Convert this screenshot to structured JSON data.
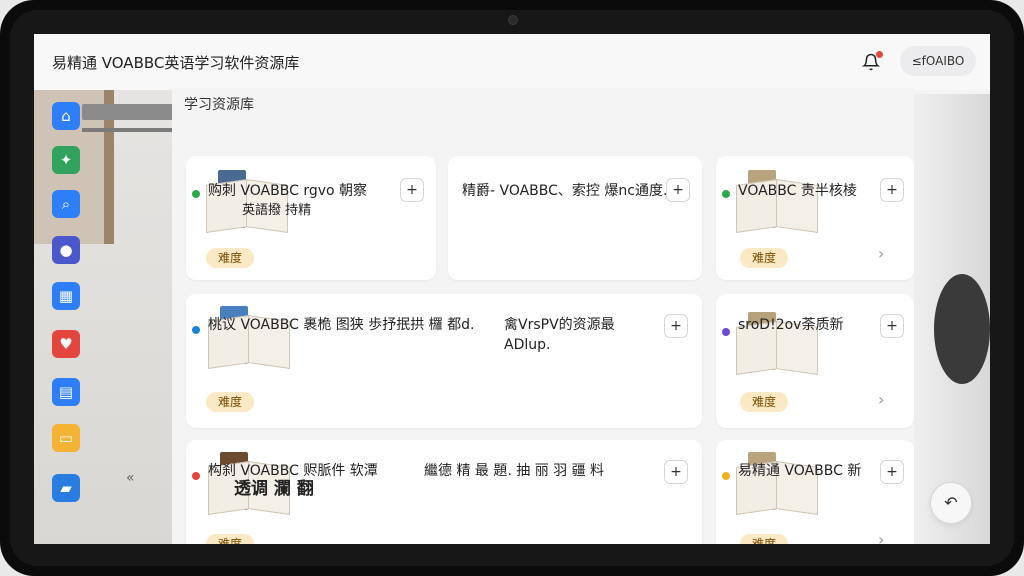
{
  "app": {
    "title": "易精通 VOABBC英语学习软件资源库",
    "user_label": "≤fOAIBO"
  },
  "section": {
    "title": "学习资源库"
  },
  "badge_label": "难度",
  "cards": [
    {
      "title": "购刺 VOABBC rgvo 朝察",
      "subtitle": "英語撥 持精",
      "has_book": true,
      "spine": "#4a6a91",
      "gem": "#2aa84a"
    },
    {
      "title": "精爵- VOABBC、索控 爆nc通度.",
      "subtitle": "",
      "has_book": false,
      "spine": "",
      "gem": ""
    },
    {
      "title": "VOABBC 责半核棱",
      "subtitle": "",
      "has_book": true,
      "spine": "#b7a47d",
      "gem": "#2aa84a"
    },
    {
      "title": "桃议 VOABBC 裹桅 图狭 歩抒抿拱 欏 都d.",
      "subtitle": "",
      "has_book": true,
      "spine": "#4a7fbd",
      "gem": "#1a83d8"
    },
    {
      "title": "禽VrsPV的资源最",
      "subtitle": "ADlup.",
      "has_book": false,
      "spine": "",
      "gem": ""
    },
    {
      "title": "sroD!2ov荼质新",
      "subtitle": "",
      "has_book": true,
      "spine": "#b6a27b",
      "gem": "#6c4bd1"
    },
    {
      "title": "构刹 VOABBC 赆脈件 软潭",
      "subtitle": "透调 瀾 翻",
      "has_book": true,
      "spine": "#6d4b2e",
      "gem": "#e2453a"
    },
    {
      "title": "繼德 精 最 題. 抽 丽 羽 疆 料",
      "subtitle": "",
      "has_book": false,
      "spine": "",
      "gem": ""
    },
    {
      "title": "易精通 VOABBC 新",
      "subtitle": "",
      "has_book": true,
      "spine": "#b9a47e",
      "gem": "#f2b21f"
    }
  ],
  "colors": {
    "accent": "#2d7ef7",
    "badge_bg": "#fbe8c4"
  }
}
